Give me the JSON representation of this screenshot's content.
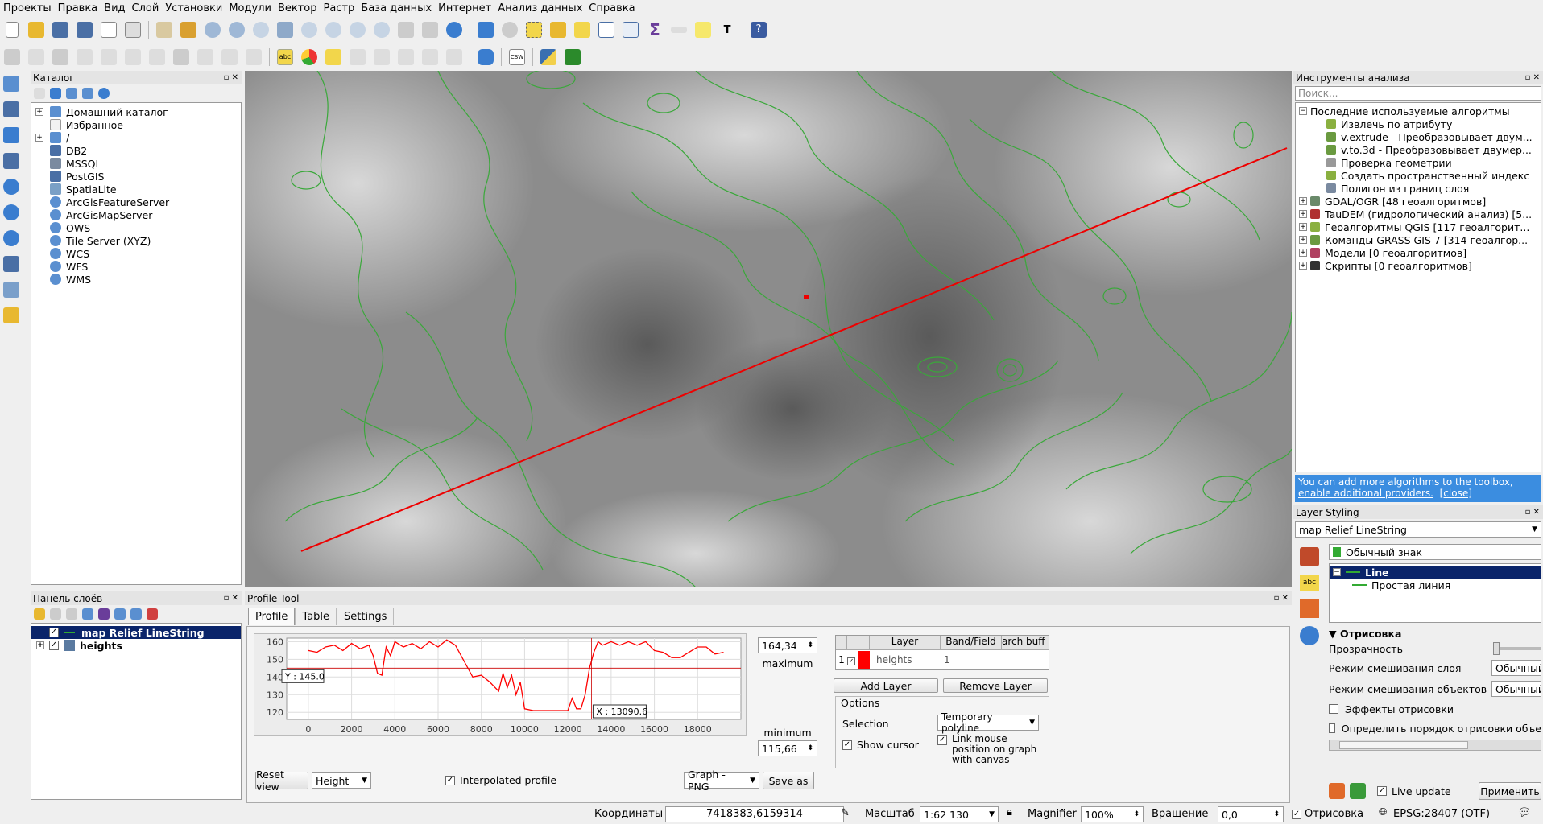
{
  "menu": [
    "Проекты",
    "Правка",
    "Вид",
    "Слой",
    "Установки",
    "Модули",
    "Вектор",
    "Растр",
    "База данных",
    "Интернет",
    "Анализ данных",
    "Справка"
  ],
  "catalog": {
    "title": "Каталог",
    "items": [
      {
        "label": "Домашний каталог",
        "icon": "folder-icon",
        "expandable": true
      },
      {
        "label": "Избранное",
        "icon": "star-icon",
        "expandable": false
      },
      {
        "label": "/",
        "icon": "folder-icon",
        "expandable": true
      },
      {
        "label": "DB2",
        "icon": "db2-icon",
        "expandable": false
      },
      {
        "label": "MSSQL",
        "icon": "mssql-icon",
        "expandable": false
      },
      {
        "label": "PostGIS",
        "icon": "postgis-icon",
        "expandable": false
      },
      {
        "label": "SpatiaLite",
        "icon": "spatialite-icon",
        "expandable": false
      },
      {
        "label": "ArcGisFeatureServer",
        "icon": "globe-icon",
        "expandable": false
      },
      {
        "label": "ArcGisMapServer",
        "icon": "globe-icon",
        "expandable": false
      },
      {
        "label": "OWS",
        "icon": "globe-icon",
        "expandable": false
      },
      {
        "label": "Tile Server (XYZ)",
        "icon": "globe-icon",
        "expandable": false
      },
      {
        "label": "WCS",
        "icon": "globe-icon",
        "expandable": false
      },
      {
        "label": "WFS",
        "icon": "globe-icon",
        "expandable": false
      },
      {
        "label": "WMS",
        "icon": "globe-icon",
        "expandable": false
      }
    ]
  },
  "layers_panel": {
    "title": "Панель слоёв",
    "layers": [
      {
        "label": "map Relief LineString",
        "selected": true,
        "checked": true
      },
      {
        "label": "heights",
        "selected": false,
        "checked": true
      }
    ]
  },
  "toolbox": {
    "title": "Инструменты анализа",
    "search_placeholder": "Поиск...",
    "recent": "Последние используемые алгоритмы",
    "recent_items": [
      "Извлечь по атрибуту",
      "v.extrude - Преобразовывает двум...",
      "v.to.3d - Преобразовывает двумер...",
      "Проверка геометрии",
      "Создать пространственный индекс",
      "Полигон из границ слоя"
    ],
    "groups": [
      "GDAL/OGR [48 геоалгоритмов]",
      "TauDEM (гидрологический анализ) [5...",
      "Геоалгоритмы QGIS [117 геоалгорит...",
      "Команды GRASS GIS 7 [314 геоалгор...",
      "Модели [0 геоалгоритмов]",
      "Скрипты [0 геоалгоритмов]"
    ],
    "notice_text": "You can add more algorithms to the toolbox,",
    "notice_link": "enable additional providers.",
    "notice_close": "[close]"
  },
  "styling": {
    "title": "Layer Styling",
    "layer": "map Relief LineString",
    "renderer": "Обычный знак",
    "symbol_root": "Line",
    "symbol_child": "Простая линия",
    "section": "Отрисовка",
    "opacity": "Прозрачность",
    "layer_blend": "Режим смешивания слоя",
    "feature_blend": "Режим смешивания объектов",
    "blend_value": "Обычный",
    "effects": "Эффекты отрисовки",
    "order": "Определить порядок отрисовки объе",
    "live_update": "Live update",
    "apply": "Применить"
  },
  "profile": {
    "title": "Profile Tool",
    "tabs": [
      "Profile",
      "Table",
      "Settings"
    ],
    "max_value": "164,34",
    "max_label": "maximum",
    "min_value": "115,66",
    "min_label": "minimum",
    "cursor_y": "Y : 145.0",
    "cursor_x": "X : 13090.6",
    "table_headers": [
      "Layer",
      "Band/Field",
      "arch buff"
    ],
    "row_num": "1",
    "row_layer": "heights",
    "row_band": "1",
    "add_layer": "Add Layer",
    "remove_layer": "Remove Layer",
    "options": "Options",
    "selection_label": "Selection",
    "selection_value": "Temporary polyline",
    "show_cursor": "Show cursor",
    "link_mouse": "Link mouse position on graph with canvas",
    "reset_view": "Reset view",
    "mode": "Height",
    "interpolated": "Interpolated profile",
    "export_format": "Graph - PNG",
    "save_as": "Save as"
  },
  "status": {
    "coord_label": "Координаты",
    "coord_value": "7418383,6159314",
    "scale_label": "Масштаб",
    "scale_value": "1:62 130",
    "magnifier_label": "Magnifier",
    "magnifier_value": "100%",
    "rotation_label": "Вращение",
    "rotation_value": "0,0",
    "render_label": "Отрисовка",
    "crs": "EPSG:28407 (OTF)"
  },
  "chart_data": {
    "type": "line",
    "xlim": [
      -1000,
      20000
    ],
    "ylim": [
      116,
      162
    ],
    "xticks": [
      0,
      2000,
      4000,
      6000,
      8000,
      10000,
      12000,
      14000,
      16000,
      18000
    ],
    "yticks": [
      120,
      130,
      140,
      150,
      160
    ],
    "cursor": {
      "x": 13090.6,
      "y": 145.0
    },
    "series": [
      {
        "color": "#ff0000",
        "x": [
          0,
          400,
          800,
          1200,
          1600,
          2000,
          2400,
          2800,
          3000,
          3200,
          3400,
          3600,
          3800,
          4000,
          4400,
          4800,
          5200,
          5600,
          6000,
          6400,
          6800,
          7200,
          7600,
          8000,
          8400,
          8800,
          9000,
          9200,
          9400,
          9600,
          9800,
          10000,
          10400,
          10800,
          11200,
          11600,
          12000,
          12200,
          12400,
          12600,
          12800,
          13000,
          13200,
          13400,
          13600,
          14000,
          14400,
          14800,
          15200,
          15600,
          16000,
          16400,
          16800,
          17200,
          17600,
          18000,
          18400,
          18800,
          19200
        ],
        "y": [
          155,
          154,
          157,
          158,
          155,
          159,
          156,
          158,
          152,
          142,
          141,
          157,
          152,
          160,
          157,
          159,
          156,
          160,
          157,
          161,
          158,
          149,
          140,
          141,
          137,
          132,
          142,
          134,
          141,
          130,
          137,
          122,
          121,
          121,
          121,
          121,
          121,
          128,
          122,
          122,
          130,
          145,
          154,
          160,
          158,
          160,
          158,
          160,
          158,
          160,
          155,
          154,
          151,
          151,
          154,
          157,
          157,
          153,
          154
        ]
      }
    ]
  }
}
